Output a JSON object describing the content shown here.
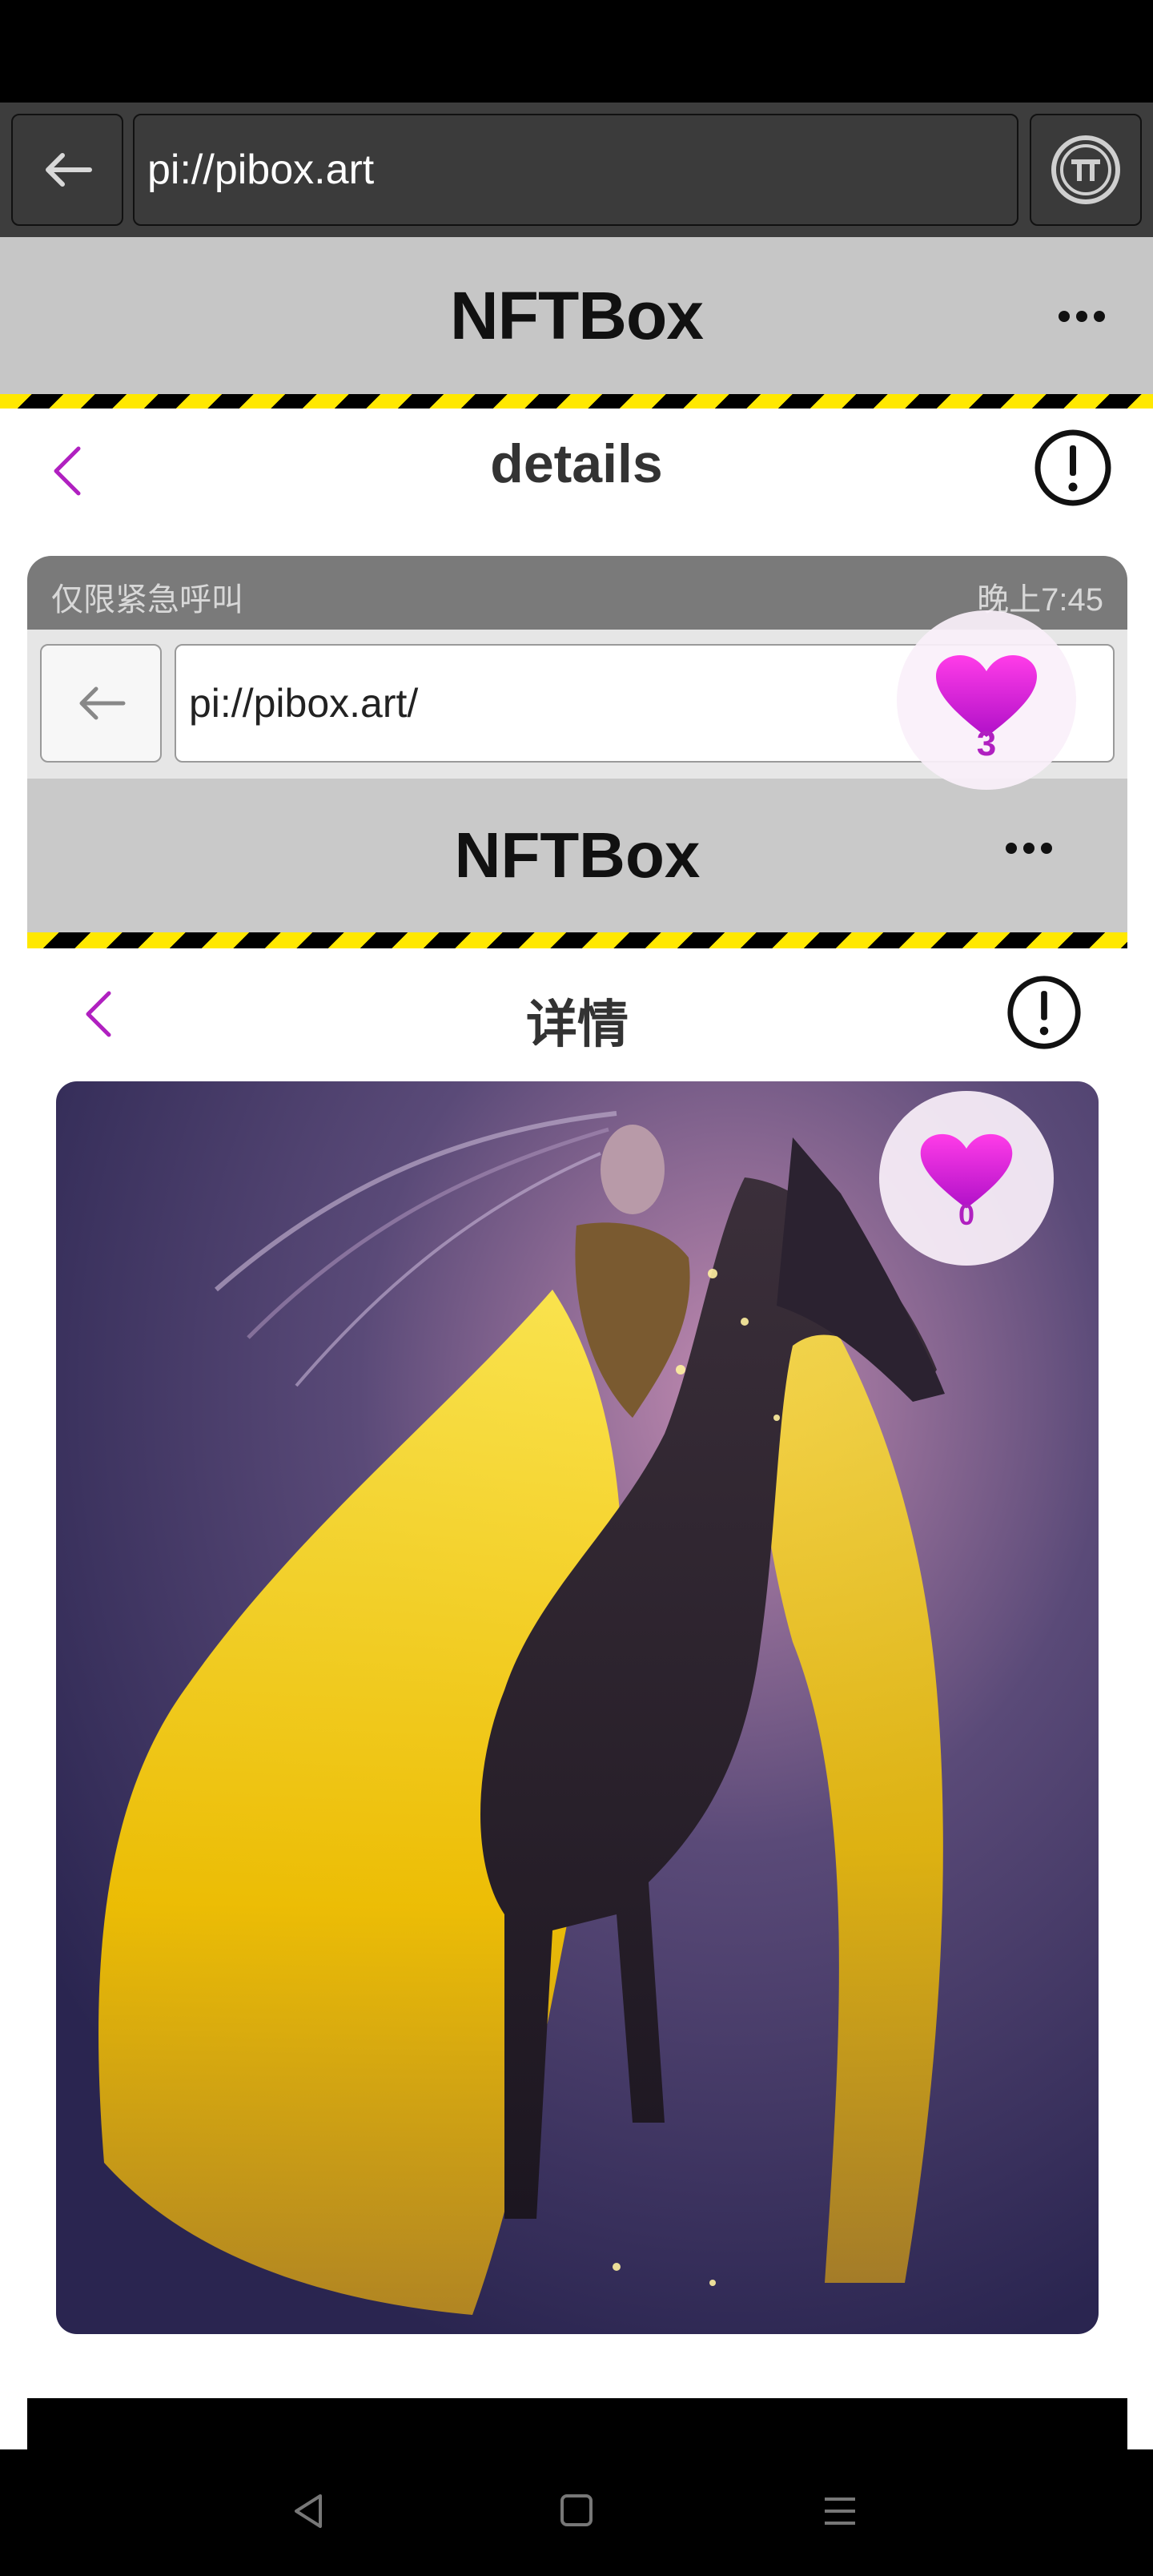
{
  "browser": {
    "url": "pi://pibox.art"
  },
  "app": {
    "title": "NFTBox"
  },
  "details": {
    "title": "details"
  },
  "embedded": {
    "status_left": "仅限紧急呼叫",
    "status_right": "晚上7:45",
    "url": "pi://pibox.art/",
    "app_title": "NFTBox",
    "details_title": "详情"
  },
  "likes": {
    "outer_count": "3",
    "inner_count": "0"
  },
  "colors": {
    "accent": "#b020c0",
    "heart": "#d21fd6",
    "stripe_yellow": "#ffe800"
  },
  "icons": [
    "back-arrow-icon",
    "pi-logo-icon",
    "more-icon",
    "chevron-left-icon",
    "alert-circle-icon",
    "heart-icon"
  ]
}
